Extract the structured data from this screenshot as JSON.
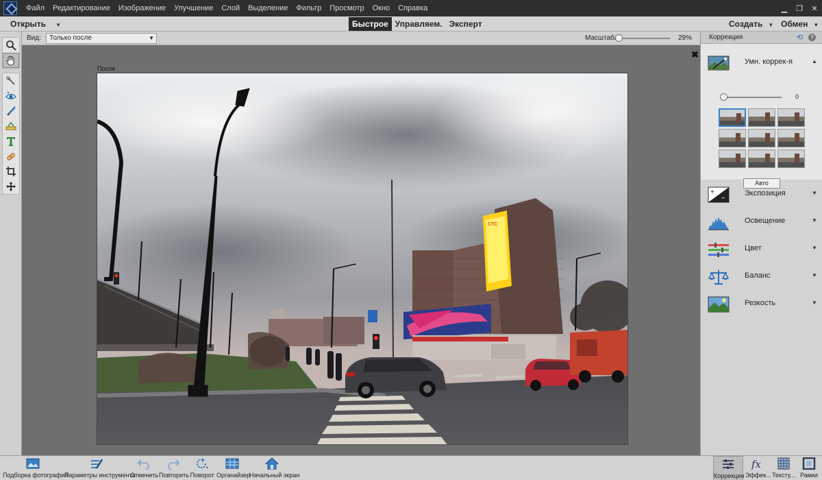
{
  "menubar": {
    "items": [
      "Файл",
      "Редактирование",
      "Изображение",
      "Улучшение",
      "Слой",
      "Выделение",
      "Фильтр",
      "Просмотр",
      "Окно",
      "Справка"
    ]
  },
  "modebar": {
    "open_label": "Открыть",
    "tabs": [
      "Быстрое",
      "Управляем.",
      "Эксперт"
    ],
    "active_tab": "Быстрое",
    "create_label": "Создать",
    "share_label": "Обмен"
  },
  "options": {
    "view_label": "Вид:",
    "view_value": "Только после",
    "zoom_label": "Масштаб:",
    "zoom_value": "29%"
  },
  "canvas": {
    "after_label": "После",
    "close_glyph": "✖"
  },
  "panel": {
    "title": "Коррекция",
    "smart": {
      "label": "Умн. коррек-я",
      "value": "0",
      "auto_label": "Авто"
    },
    "adjustments": [
      {
        "label": "Экспозиция",
        "icon": "exposure-icon"
      },
      {
        "label": "Освещение",
        "icon": "levels-icon"
      },
      {
        "label": "Цвет",
        "icon": "color-icon"
      },
      {
        "label": "Баланс",
        "icon": "balance-icon"
      },
      {
        "label": "Резкость",
        "icon": "sharpen-icon"
      }
    ]
  },
  "bottombar": {
    "left": [
      {
        "label": "Подборка фотографий",
        "icon": "photo-bin-icon"
      },
      {
        "label": "Параметры инструмента",
        "icon": "tool-options-icon"
      },
      {
        "label": "Отменить",
        "icon": "undo-icon"
      },
      {
        "label": "Повторить",
        "icon": "redo-icon"
      },
      {
        "label": "Поворот",
        "icon": "rotate-icon"
      },
      {
        "label": "Органайзер",
        "icon": "organizer-icon"
      },
      {
        "label": "Начальный экран",
        "icon": "home-icon"
      }
    ],
    "right": [
      {
        "label": "Коррекция",
        "icon": "adjustments-icon"
      },
      {
        "label": "Эффек...",
        "icon": "fx-icon"
      },
      {
        "label": "Тексту...",
        "icon": "textures-icon"
      },
      {
        "label": "Рамки",
        "icon": "frames-icon"
      }
    ]
  }
}
